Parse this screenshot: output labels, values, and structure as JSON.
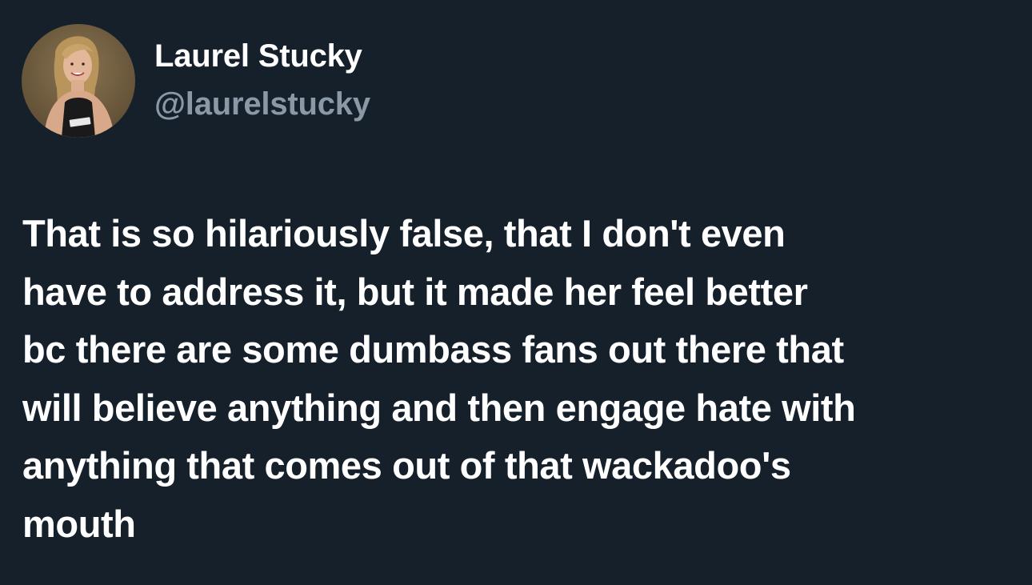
{
  "tweet": {
    "author": {
      "display_name": "Laurel Stucky",
      "handle": "@laurelstucky",
      "avatar_icon": "profile-photo"
    },
    "text_lines": [
      "That is so hilariously false, that I don't even",
      "have to address it, but it made her feel better",
      "bc there are some dumbass fans out there that",
      "will believe anything and then engage hate with",
      "anything that comes out of that wackadoo's",
      "mouth"
    ]
  },
  "colors": {
    "background": "#15202b",
    "primary_text": "#ffffff",
    "secondary_text": "#8b98a5"
  }
}
